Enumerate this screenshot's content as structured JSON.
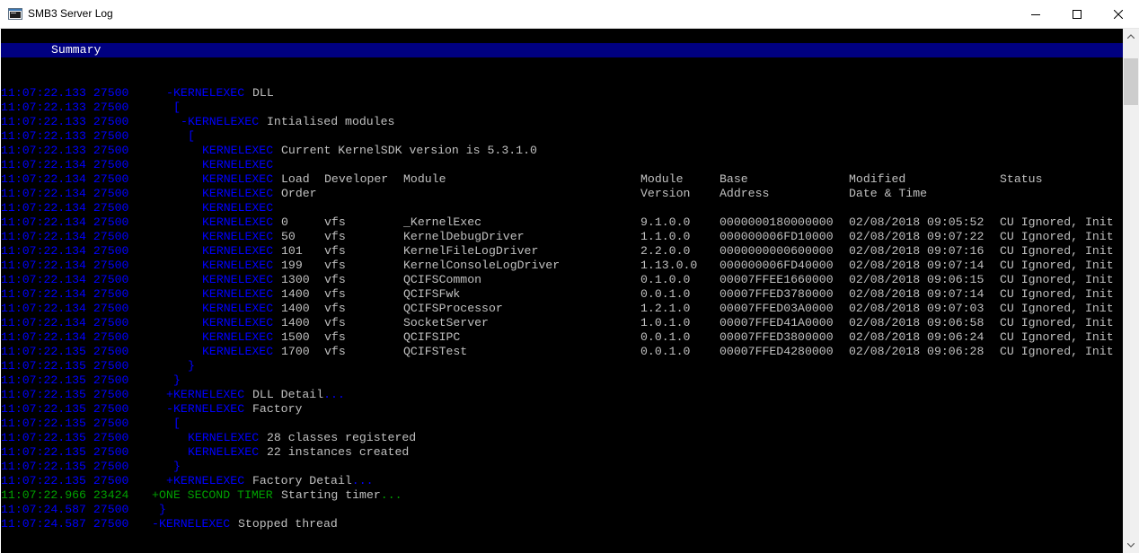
{
  "window": {
    "title": "SMB3 Server Log"
  },
  "summary": {
    "label": "Summary"
  },
  "log_lines": [
    {
      "ts": "11:07:22.133 27500",
      "indent": 23,
      "sign": "-",
      "source": "KERNELEXEC",
      "text": "DLL"
    },
    {
      "ts": "11:07:22.133 27500",
      "indent": 24,
      "brace": "["
    },
    {
      "ts": "11:07:22.133 27500",
      "indent": 25,
      "sign": "-",
      "source": "KERNELEXEC",
      "text": "Intialised modules"
    },
    {
      "ts": "11:07:22.133 27500",
      "indent": 26,
      "brace": "["
    },
    {
      "ts": "11:07:22.133 27500",
      "indent": 28,
      "source": "KERNELEXEC",
      "text": "Current KernelSDK version is 5.3.1.0"
    },
    {
      "ts": "11:07:22.134 27500",
      "indent": 28,
      "source": "KERNELEXEC"
    },
    {
      "ts": "11:07:22.134 27500",
      "indent": 28,
      "source": "KERNELEXEC",
      "row": [
        "Load",
        "Developer",
        "Module",
        "Module",
        "Base",
        "Modified",
        "Status"
      ]
    },
    {
      "ts": "11:07:22.134 27500",
      "indent": 28,
      "source": "KERNELEXEC",
      "row": [
        "Order",
        "",
        "",
        "Version",
        "Address",
        "Date & Time",
        ""
      ]
    },
    {
      "ts": "11:07:22.134 27500",
      "indent": 28,
      "source": "KERNELEXEC"
    },
    {
      "ts": "11:07:22.134 27500",
      "indent": 28,
      "source": "KERNELEXEC",
      "row": [
        "0",
        "vfs",
        "_KernelExec",
        "9.1.0.0",
        "0000000180000000",
        "02/08/2018 09:05:52",
        "CU Ignored, Init"
      ]
    },
    {
      "ts": "11:07:22.134 27500",
      "indent": 28,
      "source": "KERNELEXEC",
      "row": [
        "50",
        "vfs",
        "KernelDebugDriver",
        "1.1.0.0",
        "000000006FD10000",
        "02/08/2018 09:07:22",
        "CU Ignored, Init"
      ]
    },
    {
      "ts": "11:07:22.134 27500",
      "indent": 28,
      "source": "KERNELEXEC",
      "row": [
        "101",
        "vfs",
        "KernelFileLogDriver",
        "2.2.0.0",
        "0000000000600000",
        "02/08/2018 09:07:16",
        "CU Ignored, Init"
      ]
    },
    {
      "ts": "11:07:22.134 27500",
      "indent": 28,
      "source": "KERNELEXEC",
      "row": [
        "199",
        "vfs",
        "KernelConsoleLogDriver",
        "1.13.0.0",
        "000000006FD40000",
        "02/08/2018 09:07:14",
        "CU Ignored, Init"
      ]
    },
    {
      "ts": "11:07:22.134 27500",
      "indent": 28,
      "source": "KERNELEXEC",
      "row": [
        "1300",
        "vfs",
        "QCIFSCommon",
        "0.1.0.0",
        "00007FFEE1660000",
        "02/08/2018 09:06:15",
        "CU Ignored, Init"
      ]
    },
    {
      "ts": "11:07:22.134 27500",
      "indent": 28,
      "source": "KERNELEXEC",
      "row": [
        "1400",
        "vfs",
        "QCIFSFwk",
        "0.0.1.0",
        "00007FFED3780000",
        "02/08/2018 09:07:14",
        "CU Ignored, Init"
      ]
    },
    {
      "ts": "11:07:22.134 27500",
      "indent": 28,
      "source": "KERNELEXEC",
      "row": [
        "1400",
        "vfs",
        "QCIFSProcessor",
        "1.2.1.0",
        "00007FFED03A0000",
        "02/08/2018 09:07:03",
        "CU Ignored, Init"
      ]
    },
    {
      "ts": "11:07:22.134 27500",
      "indent": 28,
      "source": "KERNELEXEC",
      "row": [
        "1400",
        "vfs",
        "SocketServer",
        "1.0.1.0",
        "00007FFED41A0000",
        "02/08/2018 09:06:58",
        "CU Ignored, Init"
      ]
    },
    {
      "ts": "11:07:22.134 27500",
      "indent": 28,
      "source": "KERNELEXEC",
      "row": [
        "1500",
        "vfs",
        "QCIFSIPC",
        "0.0.1.0",
        "00007FFED3800000",
        "02/08/2018 09:06:24",
        "CU Ignored, Init"
      ]
    },
    {
      "ts": "11:07:22.135 27500",
      "indent": 28,
      "source": "KERNELEXEC",
      "row": [
        "1700",
        "vfs",
        "QCIFSTest",
        "0.0.1.0",
        "00007FFED4280000",
        "02/08/2018 09:06:28",
        "CU Ignored, Init"
      ]
    },
    {
      "ts": "11:07:22.135 27500",
      "indent": 26,
      "brace": "}"
    },
    {
      "ts": "11:07:22.135 27500",
      "indent": 24,
      "brace": "}"
    },
    {
      "ts": "11:07:22.135 27500",
      "indent": 23,
      "sign": "+",
      "source": "KERNELEXEC",
      "text": "DLL Detail",
      "dots": "..."
    },
    {
      "ts": "11:07:22.135 27500",
      "indent": 23,
      "sign": "-",
      "source": "KERNELEXEC",
      "text": "Factory"
    },
    {
      "ts": "11:07:22.135 27500",
      "indent": 24,
      "brace": "["
    },
    {
      "ts": "11:07:22.135 27500",
      "indent": 26,
      "source": "KERNELEXEC",
      "text": "28 classes registered"
    },
    {
      "ts": "11:07:22.135 27500",
      "indent": 26,
      "source": "KERNELEXEC",
      "text": "22 instances created"
    },
    {
      "ts": "11:07:22.135 27500",
      "indent": 24,
      "brace": "}"
    },
    {
      "ts": "11:07:22.135 27500",
      "indent": 23,
      "sign": "+",
      "source": "KERNELEXEC",
      "text": "Factory Detail",
      "dots": "..."
    },
    {
      "ts": "11:07:22.966 23424",
      "indent": 21,
      "sign": "+",
      "source": "ONE SECOND TIMER",
      "text": "Starting timer",
      "dots": "...",
      "green": true
    },
    {
      "ts": "11:07:24.587 27500",
      "indent": 22,
      "brace": "}"
    },
    {
      "ts": "11:07:24.587 27500",
      "indent": 21,
      "sign": "-",
      "source": "KERNELEXEC",
      "text": "Stopped thread"
    }
  ],
  "colors": {
    "console_bg": "#000000",
    "summary_bar": "#000080",
    "timestamp": "#0000ff",
    "timer_source": "#00a000",
    "log_text": "#c0c0c0"
  },
  "icons": {
    "app": "console-window-icon",
    "minimize": "minimize-icon",
    "maximize": "maximize-icon",
    "close": "close-icon",
    "scroll_up": "arrow-up-icon",
    "scroll_down": "arrow-down-icon"
  }
}
